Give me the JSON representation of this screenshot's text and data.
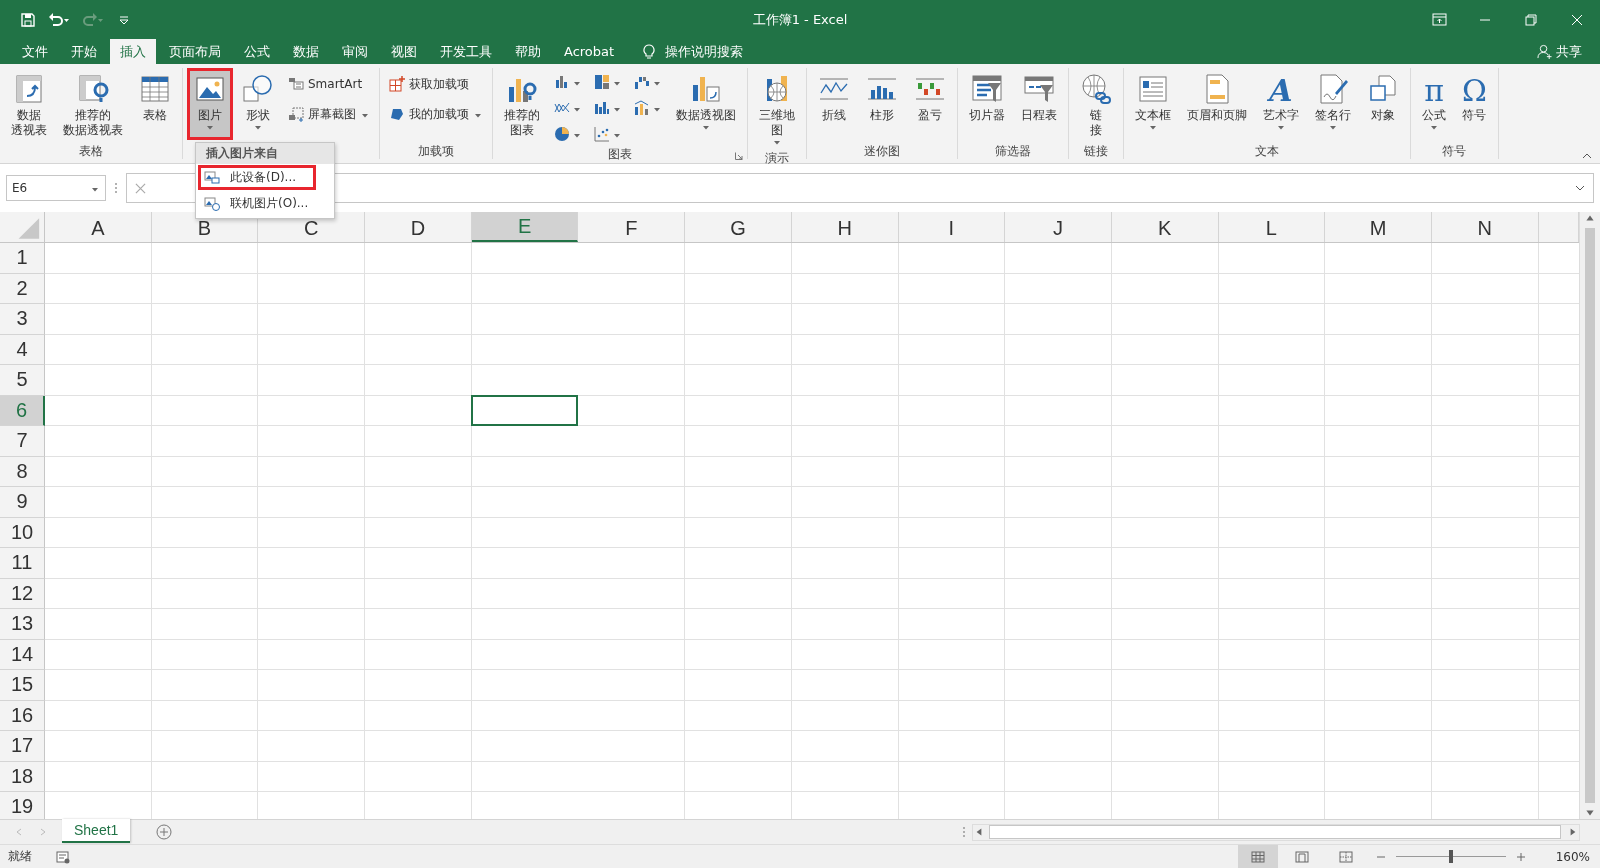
{
  "window": {
    "title": "工作簿1  -  Excel"
  },
  "tabs": [
    {
      "label": "文件",
      "selected": false
    },
    {
      "label": "开始",
      "selected": false
    },
    {
      "label": "插入",
      "selected": true
    },
    {
      "label": "页面布局",
      "selected": false
    },
    {
      "label": "公式",
      "selected": false
    },
    {
      "label": "数据",
      "selected": false
    },
    {
      "label": "审阅",
      "selected": false
    },
    {
      "label": "视图",
      "selected": false
    },
    {
      "label": "开发工具",
      "selected": false
    },
    {
      "label": "帮助",
      "selected": false
    },
    {
      "label": "Acrobat",
      "selected": false
    }
  ],
  "tell_me": {
    "placeholder": "操作说明搜索"
  },
  "share": "共享",
  "ribbon": {
    "groups": [
      {
        "label": "表格",
        "columns": [
          [
            {
              "kind": "large",
              "lines": [
                "数据",
                "透视表"
              ],
              "dropdown": false,
              "highlighted": false
            }
          ],
          [
            {
              "kind": "large",
              "lines": [
                "推荐的",
                "数据透视表"
              ],
              "dropdown": false,
              "highlighted": false
            }
          ],
          [
            {
              "kind": "large",
              "lines": [
                "表格"
              ],
              "dropdown": false,
              "highlighted": false
            }
          ]
        ]
      },
      {
        "columns": [
          [
            {
              "kind": "large",
              "lines": [
                "图片"
              ],
              "dropdown": true,
              "highlighted": true,
              "menu": {
                "title": "插入图片来自",
                "items": [
                  {
                    "label": "此设备(D)...",
                    "highlighted": true
                  },
                  {
                    "label": "联机图片(O)...",
                    "highlighted": false
                  }
                ]
              }
            }
          ],
          [
            {
              "kind": "large",
              "lines": [
                "形状"
              ],
              "dropdown": true,
              "highlighted": false
            }
          ],
          [
            {
              "kind": "small",
              "lines": [
                "SmartArt"
              ],
              "dropdown": false,
              "highlighted": false
            },
            {
              "kind": "small",
              "lines": [
                "屏幕截图"
              ],
              "dropdown": true,
              "highlighted": false
            }
          ]
        ]
      },
      {
        "label": "加载项",
        "columns": [
          [
            {
              "kind": "small",
              "lines": [
                "获取加载项"
              ],
              "dropdown": false,
              "highlighted": false
            },
            {
              "kind": "small",
              "lines": [
                "我的加载项"
              ],
              "dropdown": true,
              "highlighted": false
            }
          ]
        ]
      },
      {
        "label": "图表",
        "launcher": true,
        "columns": [
          [
            {
              "kind": "large",
              "lines": [
                "推荐的",
                "图表"
              ],
              "dropdown": false,
              "highlighted": false
            }
          ],
          [
            {
              "kind": "icon",
              "dropdown": true,
              "highlighted": false
            },
            {
              "kind": "icon",
              "dropdown": true,
              "highlighted": false
            },
            {
              "kind": "icon",
              "dropdown": true,
              "highlighted": false
            }
          ],
          [
            {
              "kind": "icon",
              "dropdown": true,
              "highlighted": false
            },
            {
              "kind": "icon",
              "dropdown": true,
              "highlighted": false
            },
            {
              "kind": "icon",
              "dropdown": true,
              "highlighted": false
            }
          ],
          [
            {
              "kind": "icon",
              "dropdown": true,
              "highlighted": false
            },
            {
              "kind": "icon",
              "dropdown": true,
              "highlighted": false
            }
          ],
          [
            {
              "kind": "large",
              "lines": [
                "数据透视图"
              ],
              "dropdown": true,
              "highlighted": false
            }
          ]
        ]
      },
      {
        "label": "演示",
        "columns": [
          [
            {
              "kind": "large",
              "lines": [
                "三维地",
                "图"
              ],
              "dropdown": true,
              "highlighted": false
            }
          ]
        ]
      },
      {
        "label": "迷你图",
        "columns": [
          [
            {
              "kind": "large",
              "lines": [
                "折线"
              ],
              "dropdown": false,
              "highlighted": false
            }
          ],
          [
            {
              "kind": "large",
              "lines": [
                "柱形"
              ],
              "dropdown": false,
              "highlighted": false
            }
          ],
          [
            {
              "kind": "large",
              "lines": [
                "盈亏"
              ],
              "dropdown": false,
              "highlighted": false
            }
          ]
        ]
      },
      {
        "label": "筛选器",
        "columns": [
          [
            {
              "kind": "large",
              "lines": [
                "切片器"
              ],
              "dropdown": false,
              "highlighted": false
            }
          ],
          [
            {
              "kind": "large",
              "lines": [
                "日程表"
              ],
              "dropdown": false,
              "highlighted": false
            }
          ]
        ]
      },
      {
        "label": "链接",
        "columns": [
          [
            {
              "kind": "large",
              "lines": [
                "链",
                "接"
              ],
              "dropdown": false,
              "highlighted": false
            }
          ]
        ]
      },
      {
        "label": "文本",
        "columns": [
          [
            {
              "kind": "large",
              "lines": [
                "文本框"
              ],
              "dropdown": true,
              "highlighted": false
            }
          ],
          [
            {
              "kind": "large",
              "lines": [
                "页眉和页脚"
              ],
              "dropdown": false,
              "highlighted": false
            }
          ],
          [
            {
              "kind": "large",
              "glyph": "A",
              "lines": [
                "艺术字"
              ],
              "dropdown": true,
              "highlighted": false
            }
          ],
          [
            {
              "kind": "large",
              "lines": [
                "签名行"
              ],
              "dropdown": true,
              "highlighted": false
            }
          ],
          [
            {
              "kind": "large",
              "lines": [
                "对象"
              ],
              "dropdown": false,
              "highlighted": false
            }
          ]
        ]
      },
      {
        "label": "符号",
        "columns": [
          [
            {
              "kind": "large",
              "glyph": "π",
              "lines": [
                "公式"
              ],
              "dropdown": true,
              "highlighted": false
            }
          ],
          [
            {
              "kind": "large",
              "glyph": "Ω",
              "lines": [
                "符号"
              ],
              "dropdown": false,
              "highlighted": false
            }
          ]
        ]
      }
    ]
  },
  "name_box": "E6",
  "columns": [
    {
      "label": "A",
      "selected": false
    },
    {
      "label": "B",
      "selected": false
    },
    {
      "label": "C",
      "selected": false
    },
    {
      "label": "D",
      "selected": false
    },
    {
      "label": "E",
      "selected": true
    },
    {
      "label": "F",
      "selected": false
    },
    {
      "label": "G",
      "selected": false
    },
    {
      "label": "H",
      "selected": false
    },
    {
      "label": "I",
      "selected": false
    },
    {
      "label": "J",
      "selected": false
    },
    {
      "label": "K",
      "selected": false
    },
    {
      "label": "L",
      "selected": false
    },
    {
      "label": "M",
      "selected": false
    },
    {
      "label": "N",
      "selected": false
    }
  ],
  "rows": [
    {
      "label": "1",
      "selected": false
    },
    {
      "label": "2",
      "selected": false
    },
    {
      "label": "3",
      "selected": false
    },
    {
      "label": "4",
      "selected": false
    },
    {
      "label": "5",
      "selected": false
    },
    {
      "label": "6",
      "selected": true
    },
    {
      "label": "7",
      "selected": false
    },
    {
      "label": "8",
      "selected": false
    },
    {
      "label": "9",
      "selected": false
    },
    {
      "label": "10",
      "selected": false
    },
    {
      "label": "11",
      "selected": false
    },
    {
      "label": "12",
      "selected": false
    },
    {
      "label": "13",
      "selected": false
    },
    {
      "label": "14",
      "selected": false
    },
    {
      "label": "15",
      "selected": false
    },
    {
      "label": "16",
      "selected": false
    },
    {
      "label": "17",
      "selected": false
    },
    {
      "label": "18",
      "selected": false
    },
    {
      "label": "19",
      "selected": false
    }
  ],
  "sheets": [
    {
      "label": "Sheet1",
      "selected": true
    }
  ],
  "status_bar": {
    "status": "就绪",
    "views": [
      {
        "selected": true
      },
      {
        "selected": false
      },
      {
        "selected": false
      }
    ],
    "zoom": {
      "level": 0.48,
      "reading": "160%"
    }
  }
}
